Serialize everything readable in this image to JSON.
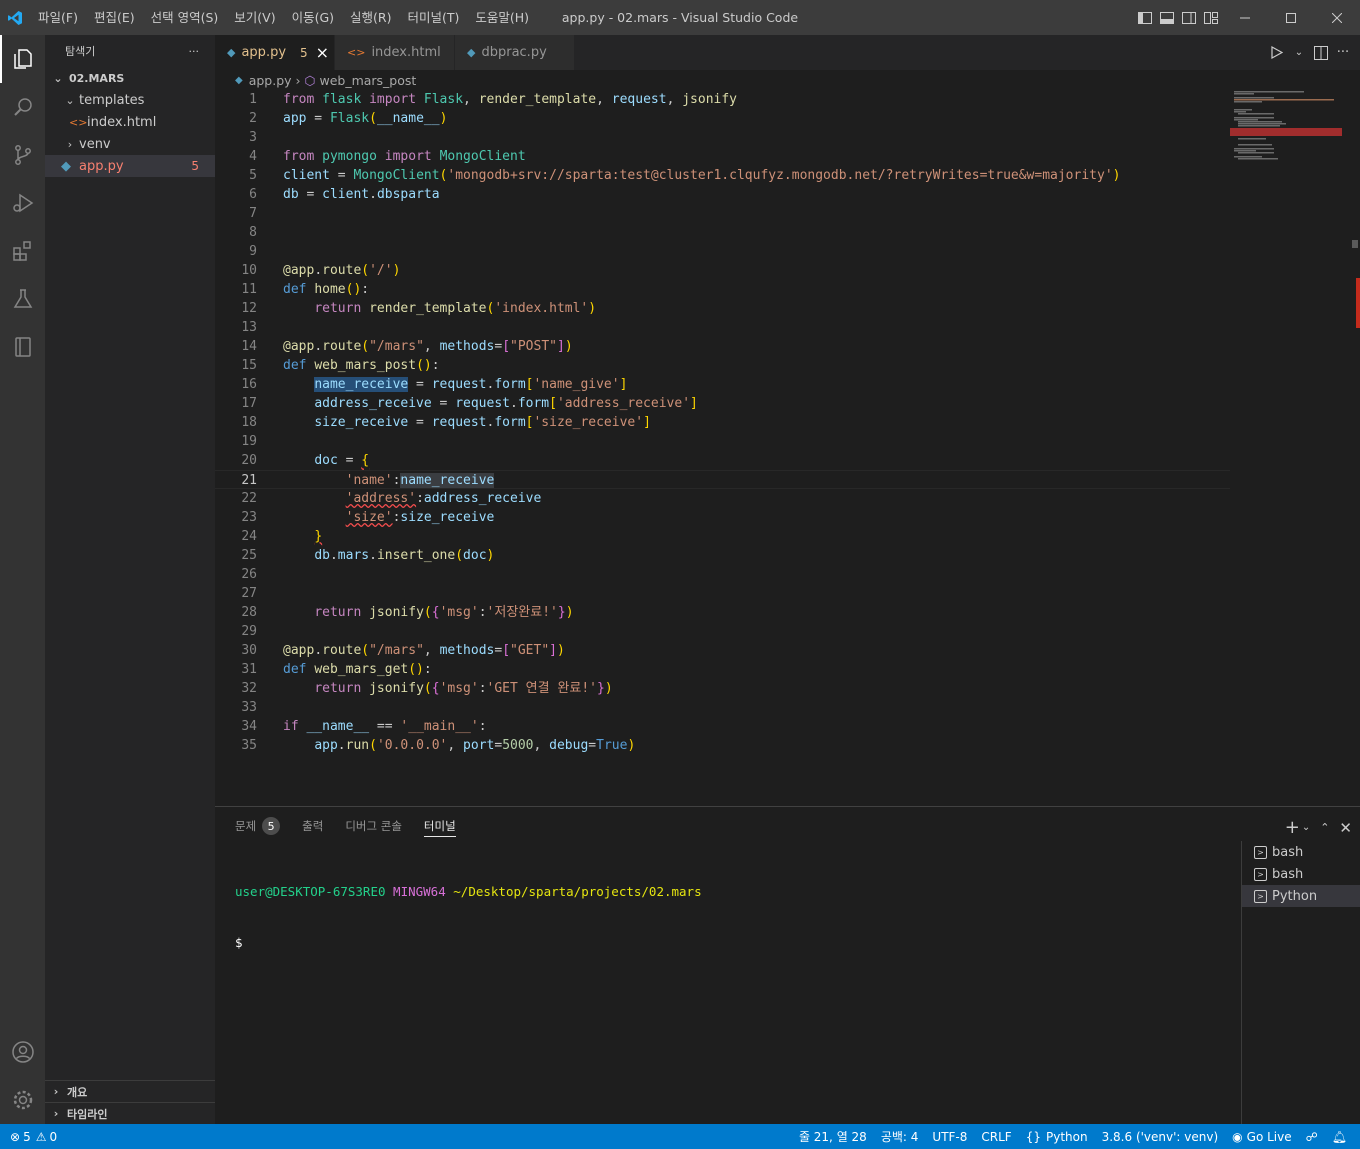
{
  "window": {
    "title": "app.py - 02.mars - Visual Studio Code",
    "menu": [
      "파일(F)",
      "편집(E)",
      "선택 영역(S)",
      "보기(V)",
      "이동(G)",
      "실행(R)",
      "터미널(T)",
      "도움말(H)"
    ]
  },
  "activity": [
    "explorer-icon",
    "search-icon",
    "source-control-icon",
    "run-debug-icon",
    "extensions-icon",
    "testing-icon",
    "remote-explorer-icon",
    "account-icon",
    "settings-gear-icon"
  ],
  "sidebar": {
    "title": "탐색기",
    "more": "···",
    "folder": "02.MARS",
    "items": [
      {
        "label": "templates"
      },
      {
        "label": "index.html"
      },
      {
        "label": "venv"
      },
      {
        "label": "app.py",
        "count": "5"
      }
    ],
    "outline": "개요",
    "timeline": "타임라인"
  },
  "tabs": [
    {
      "label": "app.py",
      "count": "5",
      "close": "×"
    },
    {
      "label": "index.html"
    },
    {
      "label": "dbprac.py"
    }
  ],
  "breadcrumb": {
    "file": "app.py",
    "symbol": "web_mars_post"
  },
  "editor": {
    "line_numbers": [
      "1",
      "2",
      "3",
      "4",
      "5",
      "6",
      "7",
      "8",
      "9",
      "10",
      "11",
      "12",
      "13",
      "14",
      "15",
      "16",
      "17",
      "18",
      "19",
      "20",
      "21",
      "22",
      "23",
      "24",
      "25",
      "26",
      "27",
      "28",
      "29",
      "30",
      "31",
      "32",
      "33",
      "34",
      "35"
    ],
    "current_line": "21"
  },
  "panel": {
    "tabs": [
      {
        "label": "문제",
        "badge": "5"
      },
      {
        "label": "출력"
      },
      {
        "label": "디버그 콘솔"
      },
      {
        "label": "터미널"
      }
    ],
    "terminal": {
      "user": "user@DESKTOP-67S3RE0",
      "shell": "MINGW64",
      "path": "~/Desktop/sparta/projects/02.mars",
      "prompt": "$"
    },
    "terminals": [
      "bash",
      "bash",
      "Python"
    ]
  },
  "status": {
    "errors": "5",
    "warnings": "0",
    "position": "줄 21, 열 28",
    "spaces": "공백: 4",
    "encoding": "UTF-8",
    "eol": "CRLF",
    "language": "Python",
    "interpreter": "3.8.6 ('venv': venv)",
    "golive": "Go Live"
  },
  "colors": {
    "accent": "#007acc",
    "titlebar": "#3c3c3c",
    "editor_bg": "#1e1e1e",
    "modified_tab": "#e2c08d",
    "error": "#f14c4c"
  }
}
